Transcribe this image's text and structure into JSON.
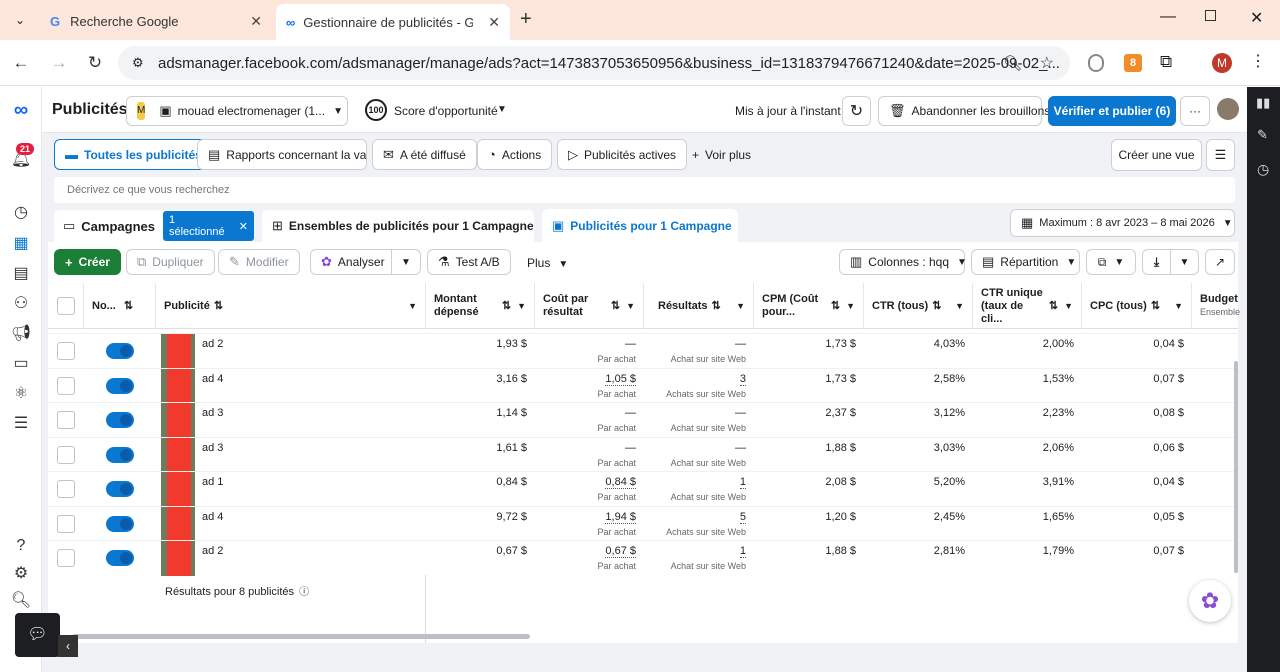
{
  "browser": {
    "tabs": [
      {
        "title": "Recherche Google"
      },
      {
        "title": "Gestionnaire de publicités - Gé"
      }
    ],
    "url": "adsmanager.facebook.com/adsmanager/manage/ads?act=1473837053650956&business_id=1318379476671240&date=2025-09-02_...",
    "extension_badge": "8",
    "profile_initial": "M"
  },
  "app": {
    "title": "Publicités",
    "account_initial": "M",
    "account_name": "mouad electromenager (1...",
    "opportunity_score": "100",
    "opportunity_label": "Score d'opportunité",
    "updated_status": "Mis à jour à l'instant",
    "discard_label": "Abandonner les brouillons",
    "publish_label": "Vérifier et publier (6)",
    "more_label": "···",
    "notif_count": "21"
  },
  "filters": {
    "all_ads": "Toutes les publicités",
    "reports": "Rapports concernant la valeur",
    "delivered": "A été diffusé",
    "actions": "Actions",
    "active": "Publicités actives",
    "see_more": "Voir plus",
    "create_view": "Créer une vue"
  },
  "search": {
    "placeholder": "Décrivez ce que vous recherchez"
  },
  "levels": {
    "campaigns": "Campagnes",
    "selected_badge": "1 sélectionné",
    "adsets": "Ensembles de publicités pour 1 Campagne",
    "ads": "Publicités pour 1 Campagne"
  },
  "date_range": "Maximum : 8 avr 2023 – 8 mai 2026",
  "toolbar": {
    "create": "Créer",
    "duplicate": "Dupliquer",
    "edit": "Modifier",
    "analyze": "Analyser",
    "ab_test": "Test A/B",
    "plus": "Plus",
    "columns": "Colonnes : hqq",
    "breakdown": "Répartition"
  },
  "table": {
    "headers": {
      "name": "No...",
      "ad": "Publicité",
      "spent": "Montant dépensé",
      "cpr": "Coût par résultat",
      "results": "Résultats",
      "cpm": "CPM (Coût pour...",
      "ctr": "CTR (tous)",
      "uctr": "CTR unique (taux de cli...",
      "cpc": "CPC (tous)",
      "budget": "Budget",
      "budget_sub": "Ensemble"
    },
    "rows": [
      {
        "name": "ad 2",
        "spent": "1,93 $",
        "cpr": "—",
        "cpr_sub": "Par achat",
        "results": "—",
        "results_sub": "Achat sur site Web",
        "cpm": "1,73 $",
        "ctr": "4,03%",
        "uctr": "2,00%",
        "cpc": "0,04 $"
      },
      {
        "name": "ad 4",
        "spent": "3,16 $",
        "cpr": "1,05 $",
        "cpr_sub": "Par achat",
        "results": "3",
        "results_sub": "Achats sur site Web",
        "cpm": "1,73 $",
        "ctr": "2,58%",
        "uctr": "1,53%",
        "cpc": "0,07 $"
      },
      {
        "name": "ad 3",
        "spent": "1,14 $",
        "cpr": "—",
        "cpr_sub": "Par achat",
        "results": "—",
        "results_sub": "Achat sur site Web",
        "cpm": "2,37 $",
        "ctr": "3,12%",
        "uctr": "2,23%",
        "cpc": "0,08 $"
      },
      {
        "name": "ad 3",
        "spent": "1,61 $",
        "cpr": "—",
        "cpr_sub": "Par achat",
        "results": "—",
        "results_sub": "Achat sur site Web",
        "cpm": "1,88 $",
        "ctr": "3,03%",
        "uctr": "2,06%",
        "cpc": "0,06 $"
      },
      {
        "name": "ad 1",
        "spent": "0,84 $",
        "cpr": "0,84 $",
        "cpr_sub": "Par achat",
        "results": "1",
        "results_sub": "Achat sur site Web",
        "cpm": "2,08 $",
        "ctr": "5,20%",
        "uctr": "3,91%",
        "cpc": "0,04 $"
      },
      {
        "name": "ad 4",
        "spent": "9,72 $",
        "cpr": "1,94 $",
        "cpr_sub": "Par achat",
        "results": "5",
        "results_sub": "Achats sur site Web",
        "cpm": "1,20 $",
        "ctr": "2,45%",
        "uctr": "1,65%",
        "cpc": "0,05 $"
      },
      {
        "name": "ad 2",
        "spent": "0,67 $",
        "cpr": "0,67 $",
        "cpr_sub": "Par achat",
        "results": "1",
        "results_sub": "Achat sur site Web",
        "cpm": "1,88 $",
        "ctr": "2,81%",
        "uctr": "1,79%",
        "cpc": "0,07 $"
      }
    ],
    "footer": "Résultats pour 8 publicités"
  }
}
